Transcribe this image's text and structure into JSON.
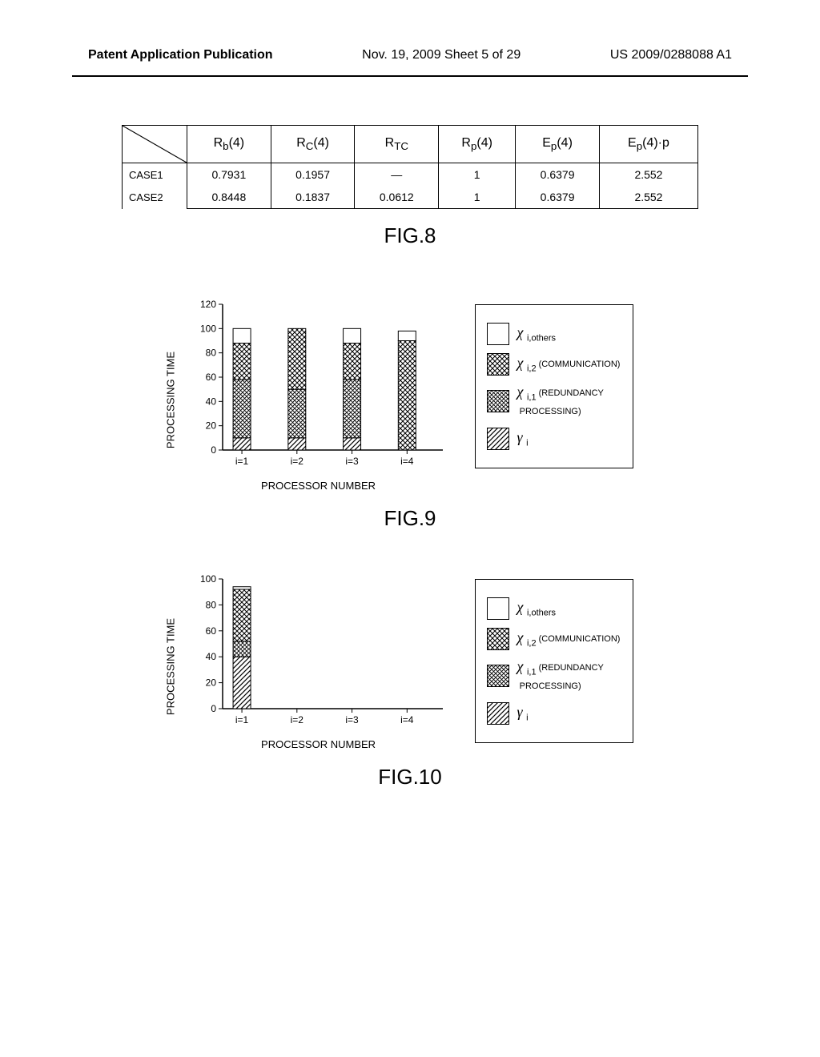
{
  "header": {
    "left": "Patent Application Publication",
    "mid": "Nov. 19, 2009  Sheet 5 of 29",
    "right": "US 2009/0288088 A1"
  },
  "fig8": {
    "caption": "FIG.8",
    "cols": [
      "R_b(4)",
      "R_C(4)",
      "R_TC",
      "R_p(4)",
      "E_p(4)",
      "E_p(4)·p"
    ],
    "rows": [
      {
        "label": "CASE1",
        "cells": [
          "0.7931",
          "0.1957",
          "—",
          "1",
          "0.6379",
          "2.552"
        ]
      },
      {
        "label": "CASE2",
        "cells": [
          "0.8448",
          "0.1837",
          "0.0612",
          "1",
          "0.6379",
          "2.552"
        ]
      }
    ]
  },
  "chart_data": [
    {
      "id": "fig9",
      "caption": "FIG.9",
      "type": "bar",
      "stacked": true,
      "xlabel": "PROCESSOR NUMBER",
      "ylabel": "PROCESSING TIME",
      "categories": [
        "i=1",
        "i=2",
        "i=3",
        "i=4"
      ],
      "ylim": [
        0,
        120
      ],
      "yticks": [
        0,
        20,
        40,
        60,
        80,
        100,
        120
      ],
      "series": [
        {
          "name": "gamma_i",
          "pattern": "diag",
          "values": [
            10,
            10,
            10,
            0
          ]
        },
        {
          "name": "x_i1",
          "pattern": "cross",
          "values": [
            48,
            40,
            48,
            0
          ]
        },
        {
          "name": "x_i2",
          "pattern": "hatch",
          "values": [
            30,
            50,
            30,
            90
          ]
        },
        {
          "name": "x_iothers",
          "pattern": "others",
          "values": [
            12,
            0,
            12,
            8
          ]
        }
      ]
    },
    {
      "id": "fig10",
      "caption": "FIG.10",
      "type": "bar",
      "stacked": true,
      "xlabel": "PROCESSOR NUMBER",
      "ylabel": "PROCESSING TIME",
      "categories": [
        "i=1",
        "i=2",
        "i=3",
        "i=4"
      ],
      "ylim": [
        0,
        100
      ],
      "yticks": [
        0,
        20,
        40,
        60,
        80,
        100
      ],
      "series": [
        {
          "name": "gamma_i",
          "pattern": "diag",
          "values": [
            40,
            0,
            0,
            0
          ]
        },
        {
          "name": "x_i1",
          "pattern": "cross",
          "values": [
            12,
            0,
            0,
            0
          ]
        },
        {
          "name": "x_i2",
          "pattern": "hatch",
          "values": [
            40,
            0,
            0,
            0
          ]
        },
        {
          "name": "x_iothers",
          "pattern": "others",
          "values": [
            2,
            0,
            0,
            0
          ]
        }
      ]
    }
  ],
  "legend": {
    "items": [
      {
        "pattern": "others",
        "sym": "χ",
        "sub": "i,others",
        "note": ""
      },
      {
        "pattern": "hatch",
        "sym": "χ",
        "sub": "i,2",
        "note": "(COMMUNICATION)"
      },
      {
        "pattern": "cross",
        "sym": "χ",
        "sub": "i,1",
        "note": "(REDUNDANCY PROCESSING)"
      },
      {
        "pattern": "diag",
        "sym": "γ",
        "sub": "i",
        "note": ""
      }
    ]
  }
}
